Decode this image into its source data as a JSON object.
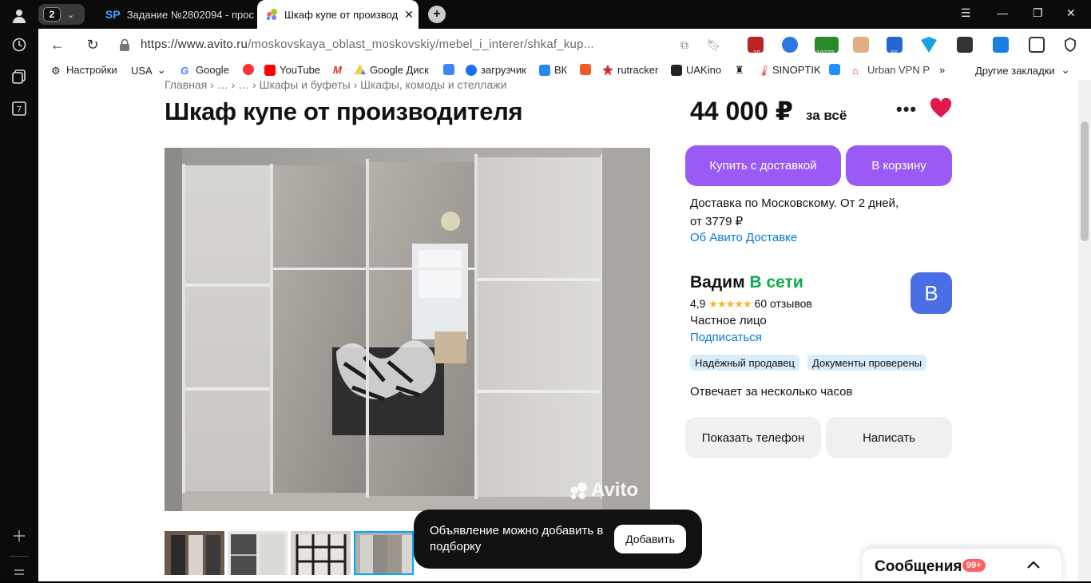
{
  "browser": {
    "tab_count": "2",
    "tabs": [
      {
        "label": "Задание №2802094 - прос",
        "favicon": "SP"
      },
      {
        "label": "Шкаф купе от производ",
        "close": "✕"
      }
    ],
    "url_host": "https://www.avito.ru",
    "url_path": "/moskovskaya_oblast_moskovskiy/mebel_i_interer/shkaf_kup...",
    "bookmarks": [
      "Настройки",
      "USA",
      "Google",
      "YouTube",
      "Google Диск",
      "загрузчик",
      "ВК",
      "rutracker",
      "UAKino",
      "SINOPTIK",
      "Urban VPN P",
      "Другие закладки"
    ],
    "ext_badges": [
      "19",
      "10373",
      "66"
    ]
  },
  "page": {
    "breadcrumb": "Главная  ›  …  ›  …  ›  Шкафы и буфеты  ›  Шкафы, комоды и стеллажи",
    "title": "Шкаф купе от производителя",
    "price": "44 000 ₽",
    "price_suffix": "за всё",
    "more": "•••",
    "buy_delivery": "Купить с доставкой",
    "to_cart": "В корзину",
    "delivery_line1": "Доставка по Московскому. От 2 дней,",
    "delivery_line2": "от 3779 ₽",
    "delivery_link": "Об Авито Доставке",
    "seller_name": "Вадим",
    "seller_status": "В сети",
    "rating": "4,9",
    "stars": "★★★★★",
    "reviews": "60 отзывов",
    "seller_type": "Частное лицо",
    "subscribe": "Подписаться",
    "badge1": "Надёжный продавец",
    "badge2": "Документы проверены",
    "reply_time": "Отвечает за несколько часов",
    "show_phone": "Показать телефон",
    "write": "Написать",
    "avatar_letter": "В",
    "watermark": "Avito",
    "toast_msg": "Объявление можно добавить в подборку",
    "toast_add": "Добавить",
    "messages_label": "Сообщения",
    "messages_count": "99+"
  },
  "colors": {
    "accent_purple": "#9b59f5",
    "link_blue": "#0a77d6",
    "online_green": "#11a94e",
    "heart_red": "#e0194a",
    "avatar_blue": "#4a6ee6"
  }
}
